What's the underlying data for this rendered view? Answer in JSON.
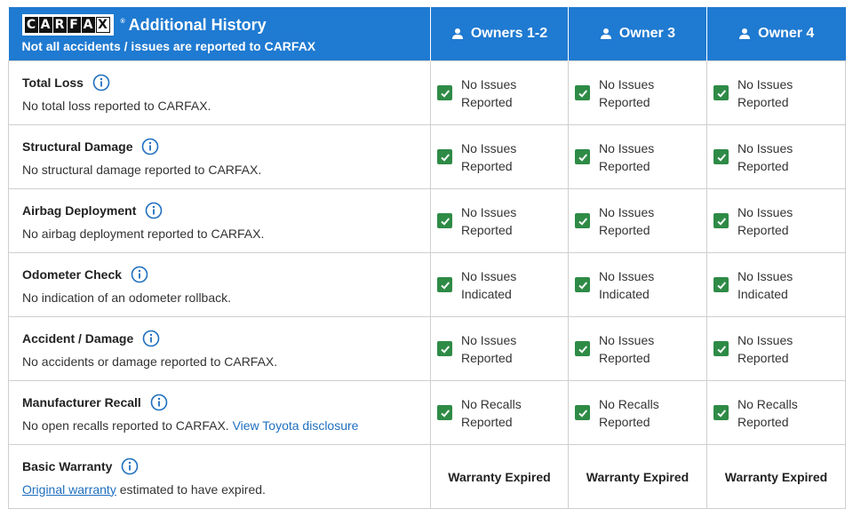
{
  "header": {
    "logo_letters": [
      "C",
      "A",
      "R",
      "F",
      "A",
      "X"
    ],
    "logo_tm": "®",
    "title": "Additional History",
    "subtitle": "Not all accidents / issues are reported to CARFAX",
    "owner_columns": [
      "Owners 1-2",
      "Owner 3",
      "Owner 4"
    ]
  },
  "rows": [
    {
      "title": "Total Loss",
      "text": "No total loss reported to CARFAX.",
      "status": [
        "No Issues Reported",
        "No Issues Reported",
        "No Issues Reported"
      ]
    },
    {
      "title": "Structural Damage",
      "text": "No structural damage reported to CARFAX.",
      "status": [
        "No Issues Reported",
        "No Issues Reported",
        "No Issues Reported"
      ]
    },
    {
      "title": "Airbag Deployment",
      "text": "No airbag deployment reported to CARFAX.",
      "status": [
        "No Issues Reported",
        "No Issues Reported",
        "No Issues Reported"
      ]
    },
    {
      "title": "Odometer Check",
      "text": "No indication of an odometer rollback.",
      "status": [
        "No Issues Indicated",
        "No Issues Indicated",
        "No Issues Indicated"
      ]
    },
    {
      "title": "Accident / Damage",
      "text": "No accidents or damage reported to CARFAX.",
      "status": [
        "No Issues Reported",
        "No Issues Reported",
        "No Issues Reported"
      ]
    },
    {
      "title": "Manufacturer Recall",
      "text": "No open recalls reported to CARFAX.",
      "link": "View Toyota disclosure",
      "status": [
        "No Recalls Reported",
        "No Recalls Reported",
        "No Recalls Reported"
      ]
    },
    {
      "title": "Basic Warranty",
      "link": "Original warranty",
      "text": "estimated to have expired.",
      "status": [
        "Warranty Expired",
        "Warranty Expired",
        "Warranty Expired"
      ]
    }
  ],
  "colors": {
    "header_bg": "#1f7ad1",
    "check": "#2e8b46",
    "link": "#1f6fbf"
  }
}
